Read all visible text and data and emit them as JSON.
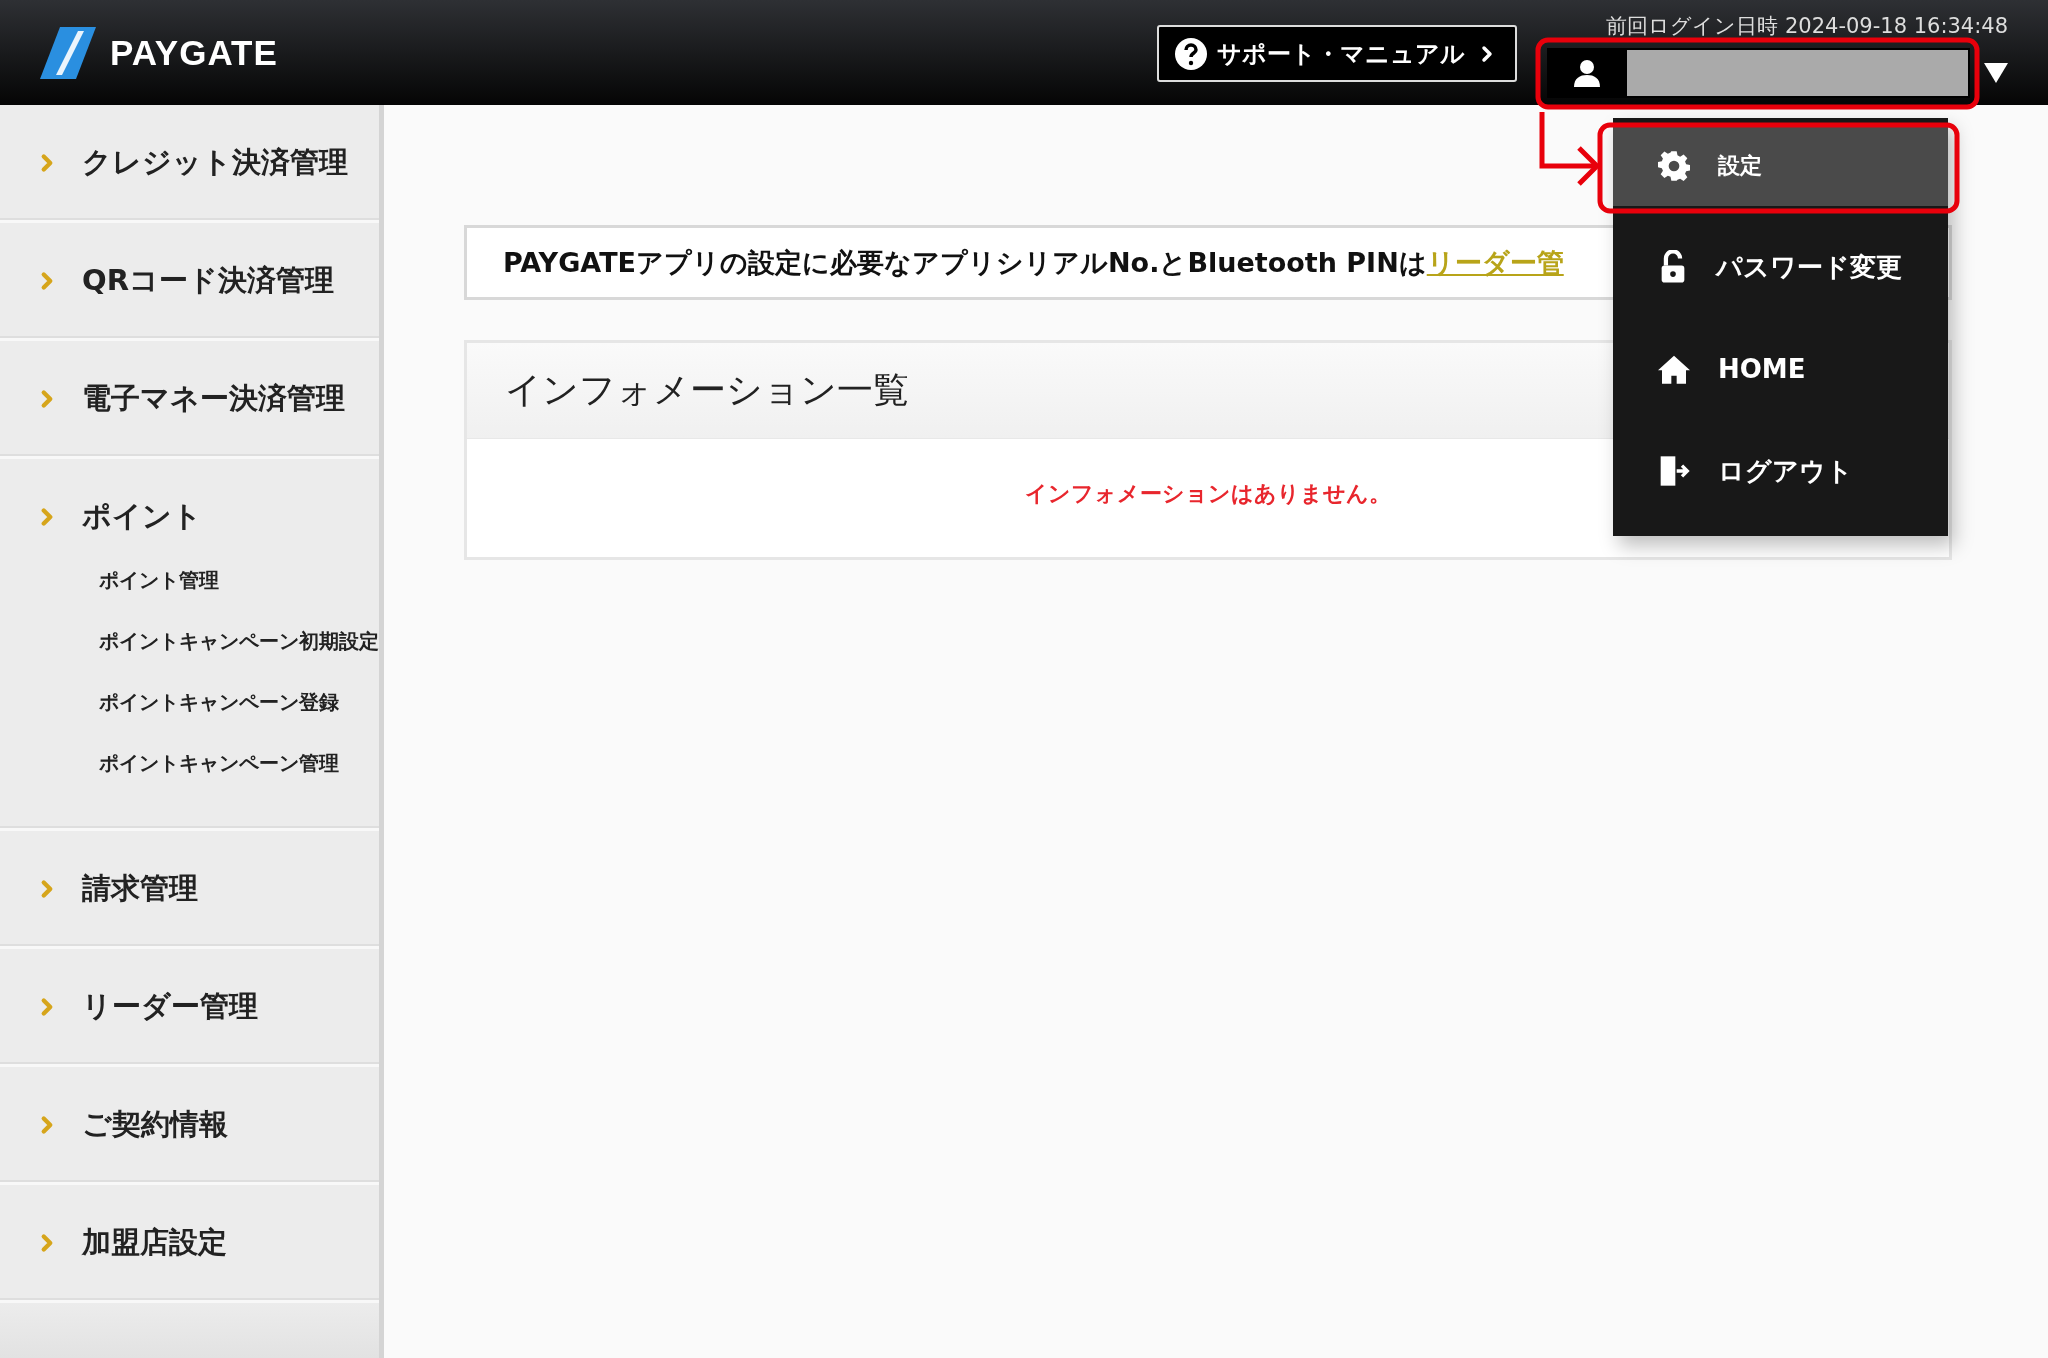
{
  "header": {
    "logo": "PAYGATE",
    "support_button": "サポート・マニュアル",
    "last_login": "前回ログイン日時 2024-09-18 16:34:48"
  },
  "user_menu": {
    "expanded": true,
    "items": [
      {
        "kind": "settings",
        "label": "設定",
        "selected": true
      },
      {
        "kind": "password",
        "label": "パスワード変更",
        "selected": false
      },
      {
        "kind": "home",
        "label": "HOME",
        "selected": false
      },
      {
        "kind": "logout",
        "label": "ログアウト",
        "selected": false
      }
    ]
  },
  "sidebar": {
    "items": [
      {
        "label": "クレジット決済管理"
      },
      {
        "label": "QRコード決済管理"
      },
      {
        "label": "電子マネー決済管理"
      },
      {
        "label": "ポイント",
        "children": [
          {
            "label": "ポイント管理"
          },
          {
            "label": "ポイントキャンペーン初期設定"
          },
          {
            "label": "ポイントキャンペーン登録"
          },
          {
            "label": "ポイントキャンペーン管理"
          }
        ]
      },
      {
        "label": "請求管理"
      },
      {
        "label": "リーダー管理"
      },
      {
        "label": "ご契約情報"
      },
      {
        "label": "加盟店設定"
      }
    ]
  },
  "notice": {
    "text": "PAYGATEアプリの設定に必要なアプリシリアルNo.とBluetooth PINは",
    "link": "リーダー管"
  },
  "info_panel": {
    "title": "インフォメーション一覧",
    "message": "インフォメーションはありません。"
  }
}
